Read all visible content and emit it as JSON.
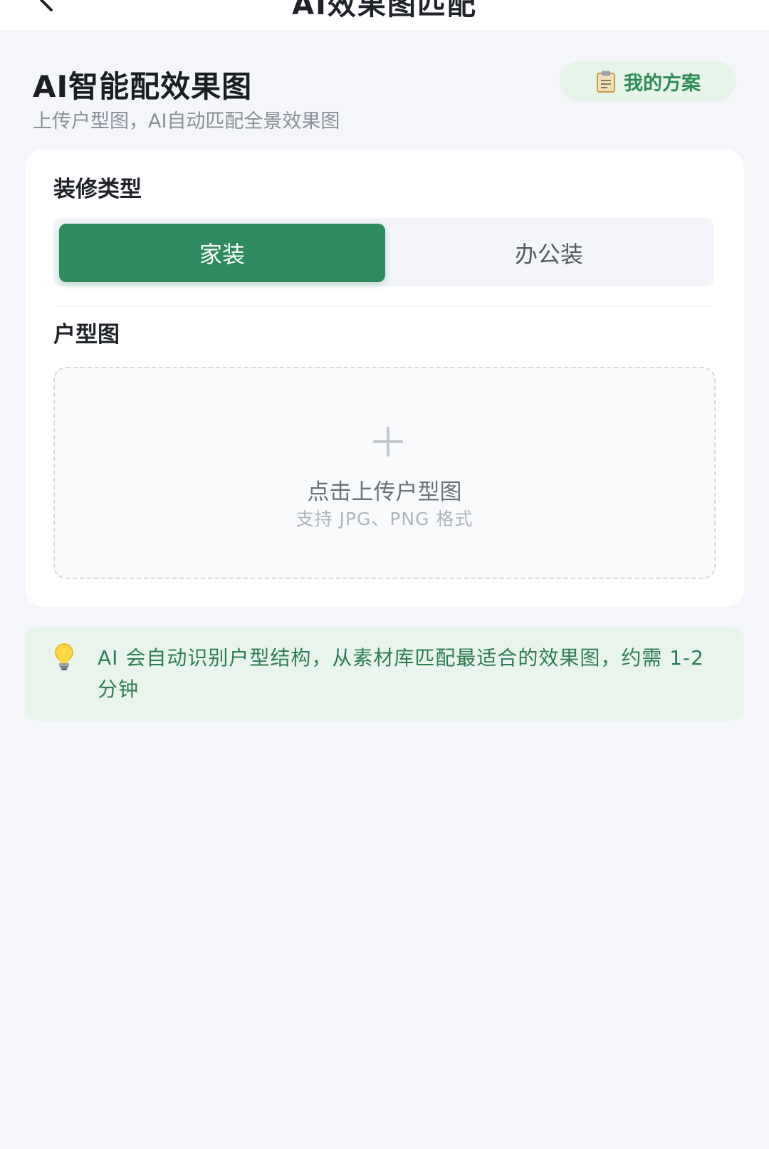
{
  "nav": {
    "title": "AI效果图匹配"
  },
  "header": {
    "title": "AI智能配效果图",
    "subtitle": "上传户型图，AI自动匹配全景效果图",
    "plan_button_label": "我的方案",
    "plan_button_icon": "clipboard-icon"
  },
  "decoration_type": {
    "label": "装修类型",
    "options": [
      "家装",
      "办公装"
    ],
    "selected": "家装"
  },
  "floor_plan": {
    "label": "户型图",
    "upload_title": "点击上传户型图",
    "upload_hint": "支持 JPG、PNG 格式",
    "upload_icon": "plus-icon"
  },
  "tip": {
    "icon": "lightbulb-icon",
    "text": "AI 会自动识别户型结构，从素材库匹配最适合的效果图，约需 1-2 分钟"
  },
  "colors": {
    "accent": "#2e8b5f",
    "accent_light": "#e7f4ea",
    "background": "#f4f6f9"
  }
}
